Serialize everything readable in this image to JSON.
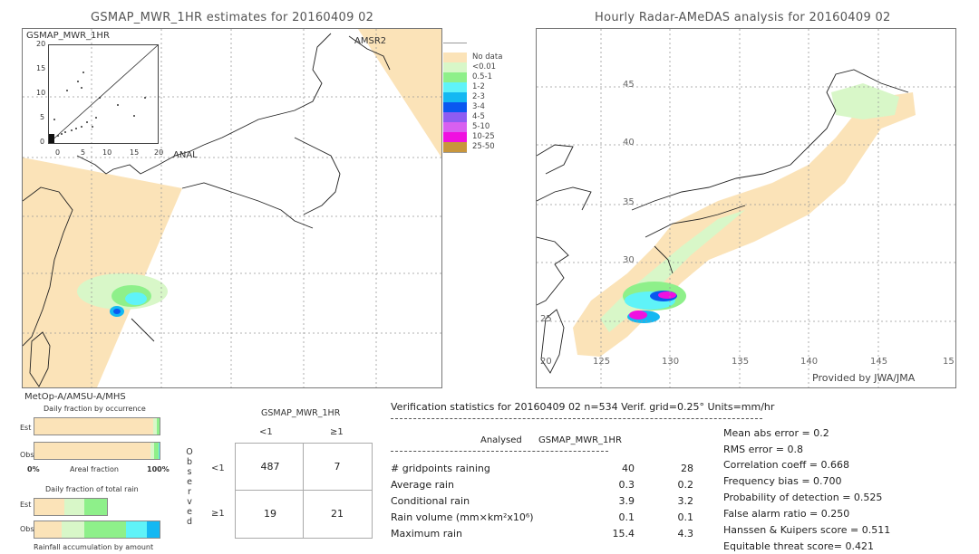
{
  "left_panel": {
    "title": "GSMAP_MWR_1HR estimates for 20160409 02",
    "inset_label": "GSMAP_MWR_1HR",
    "inset_y_ticks": [
      "20",
      "15",
      "10",
      "5",
      "0"
    ],
    "inset_x_ticks": [
      "0",
      "5",
      "10",
      "15",
      "20"
    ],
    "inset_x_label": "ANAL",
    "swath_label": "AMSR2",
    "sensor_label": "MetOp-A/AMSU-A/MHS"
  },
  "right_panel": {
    "title": "Hourly Radar-AMeDAS analysis for 20160409 02",
    "lat_ticks": [
      "45",
      "40",
      "35",
      "30",
      "25",
      "20"
    ],
    "lon_ticks": [
      "125",
      "130",
      "135",
      "140",
      "145",
      "15"
    ],
    "credit": "Provided by JWA/JMA"
  },
  "legend": {
    "items": [
      {
        "label": "",
        "color": "#ffffff"
      },
      {
        "label": "No data",
        "color": "#fbe3b8"
      },
      {
        "label": "<0.01",
        "color": "#d8f7c8"
      },
      {
        "label": "0.5-1",
        "color": "#8ef08a"
      },
      {
        "label": "1-2",
        "color": "#5ff3f8"
      },
      {
        "label": "2-3",
        "color": "#14b8f2"
      },
      {
        "label": "3-4",
        "color": "#0a58f0"
      },
      {
        "label": "4-5",
        "color": "#8e5cf2"
      },
      {
        "label": "5-10",
        "color": "#d860f0"
      },
      {
        "label": "10-25",
        "color": "#f010e0"
      },
      {
        "label": "25-50",
        "color": "#c8963c"
      }
    ]
  },
  "occurrence_chart": {
    "title": "Daily fraction by occurrence",
    "est_label": "Est",
    "obs_label": "Obs",
    "axis_left": "0%",
    "axis_mid": "Areal fraction",
    "axis_right": "100%",
    "est_segments": [
      {
        "fraction": 0.948,
        "color": "#fbe3b8"
      },
      {
        "fraction": 0.032,
        "color": "#d8f7c8"
      },
      {
        "fraction": 0.02,
        "color": "#8ef08a"
      }
    ],
    "obs_segments": [
      {
        "fraction": 0.925,
        "color": "#fbe3b8"
      },
      {
        "fraction": 0.035,
        "color": "#d8f7c8"
      },
      {
        "fraction": 0.03,
        "color": "#8ef08a"
      },
      {
        "fraction": 0.01,
        "color": "#5ff3f8"
      }
    ]
  },
  "rain_chart": {
    "title": "Daily fraction of total rain",
    "est_label": "Est",
    "obs_label": "Obs",
    "footer": "Rainfall accumulation by amount",
    "est_segments": [
      {
        "fraction": 0.41,
        "color": "#fbe3b8"
      },
      {
        "fraction": 0.28,
        "color": "#d8f7c8"
      },
      {
        "fraction": 0.31,
        "color": "#8ef08a"
      }
    ],
    "est_width_fraction": 0.58,
    "obs_segments": [
      {
        "fraction": 0.22,
        "color": "#fbe3b8"
      },
      {
        "fraction": 0.18,
        "color": "#d8f7c8"
      },
      {
        "fraction": 0.33,
        "color": "#8ef08a"
      },
      {
        "fraction": 0.17,
        "color": "#5ff3f8"
      },
      {
        "fraction": 0.1,
        "color": "#14b8f2"
      }
    ]
  },
  "contingency": {
    "header": "GSMAP_MWR_1HR",
    "col_labels": [
      "<1",
      "≥1"
    ],
    "row_labels": [
      "<1",
      "≥1"
    ],
    "side_label": [
      "O",
      "b",
      "s",
      "e",
      "r",
      "v",
      "e",
      "d"
    ],
    "cells": [
      [
        "487",
        "7"
      ],
      [
        "19",
        "21"
      ]
    ]
  },
  "verification": {
    "header": "Verification statistics for 20160409 02   n=534   Verif. grid=0.25°   Units=mm/hr",
    "col_analysed": "Analysed",
    "col_model": "GSMAP_MWR_1HR",
    "rows": [
      {
        "label": "# gridpoints raining",
        "analysed": "40",
        "model": "28"
      },
      {
        "label": "Average rain",
        "analysed": "0.3",
        "model": "0.2"
      },
      {
        "label": "Conditional rain",
        "analysed": "3.9",
        "model": "3.2"
      },
      {
        "label": "Rain volume (mm×km²x10⁶)",
        "analysed": "0.1",
        "model": "0.1"
      },
      {
        "label": "Maximum rain",
        "analysed": "15.4",
        "model": "4.3"
      }
    ],
    "scores": [
      "Mean abs error = 0.2",
      "RMS error = 0.8",
      "Correlation coeff = 0.668",
      "Frequency bias = 0.700",
      "Probability of detection = 0.525",
      "False alarm ratio = 0.250",
      "Hanssen & Kuipers score = 0.511",
      "Equitable threat score= 0.421"
    ]
  }
}
